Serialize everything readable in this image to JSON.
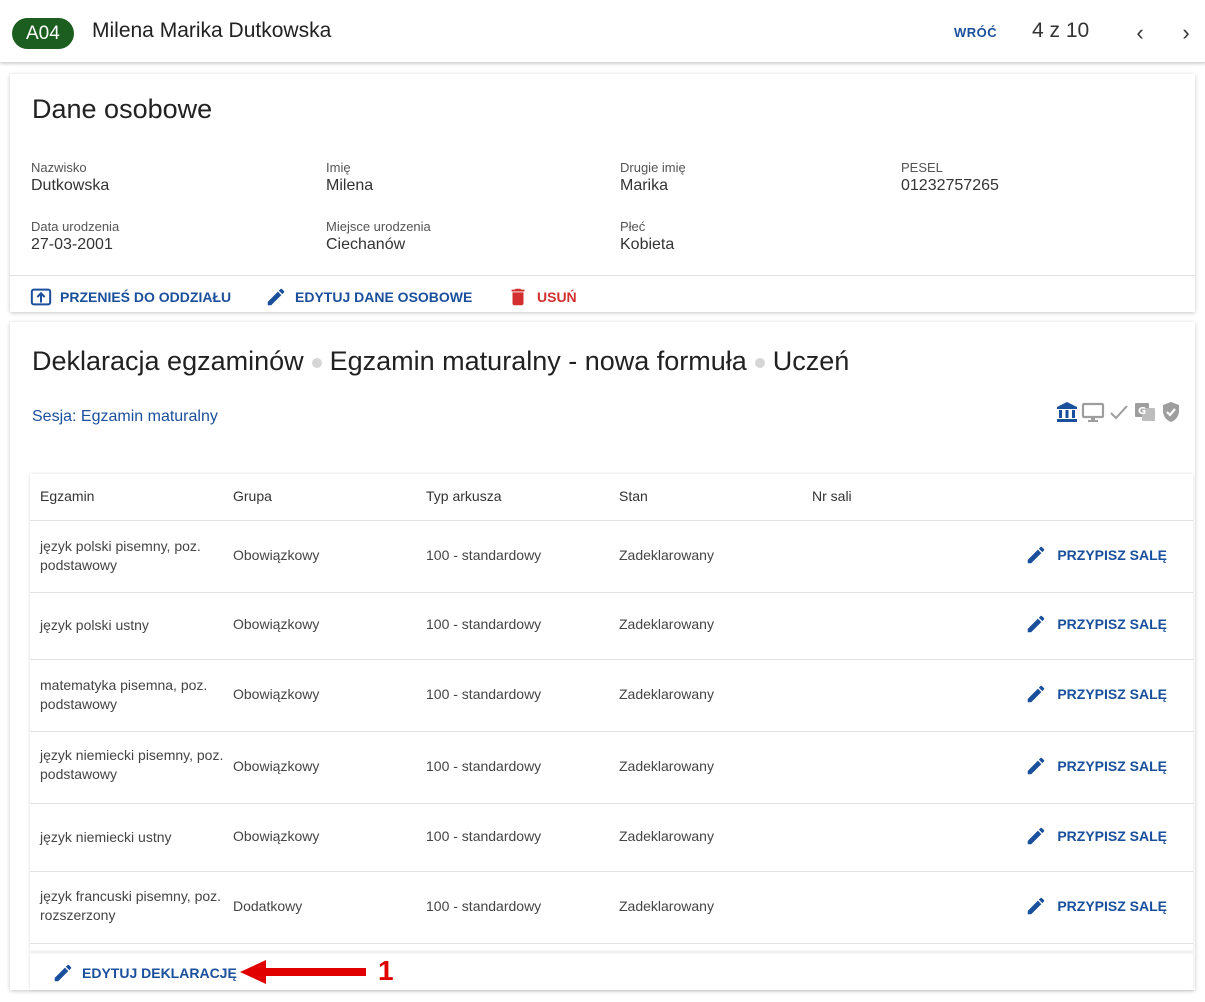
{
  "header": {
    "badge": "A04",
    "student_name": "Milena Marika Dutkowska",
    "back_label": "WRÓĆ",
    "pager": "4 z 10",
    "prev_icon": "chevron-left-icon",
    "next_icon": "chevron-right-icon"
  },
  "personal": {
    "title": "Dane osobowe",
    "fields": [
      {
        "label": "Nazwisko",
        "value": "Dutkowska"
      },
      {
        "label": "Imię",
        "value": "Milena"
      },
      {
        "label": "Drugie imię",
        "value": "Marika"
      },
      {
        "label": "PESEL",
        "value": "01232757265"
      },
      {
        "label": "Data urodzenia",
        "value": "27-03-2001"
      },
      {
        "label": "Miejsce urodzenia",
        "value": "Ciechanów"
      },
      {
        "label": "Płeć",
        "value": "Kobieta"
      }
    ],
    "actions": {
      "move": "PRZENIEŚ DO ODDZIAŁU",
      "edit": "EDYTUJ DANE OSOBOWE",
      "delete": "USUŃ"
    }
  },
  "declaration": {
    "title_parts": [
      "Deklaracja egzaminów",
      "Egzamin maturalny - nowa formuła",
      "Uczeń"
    ],
    "session": "Sesja: Egzamin maturalny",
    "status_icons": [
      "institution-icon",
      "monitor-icon",
      "check-icon",
      "translate-icon",
      "shield-check-icon"
    ],
    "columns": [
      "Egzamin",
      "Grupa",
      "Typ arkusza",
      "Stan",
      "Nr sali"
    ],
    "rows": [
      {
        "exam": "język polski pisemny, poz. podstawowy",
        "group": "Obowiązkowy",
        "sheet": "100 - standardowy",
        "state": "Zadeklarowany",
        "room": "",
        "action": "PRZYPISZ SALĘ"
      },
      {
        "exam": "język polski ustny",
        "group": "Obowiązkowy",
        "sheet": "100 - standardowy",
        "state": "Zadeklarowany",
        "room": "",
        "action": "PRZYPISZ SALĘ"
      },
      {
        "exam": "matematyka pisemna, poz. podstawowy",
        "group": "Obowiązkowy",
        "sheet": "100 - standardowy",
        "state": "Zadeklarowany",
        "room": "",
        "action": "PRZYPISZ SALĘ"
      },
      {
        "exam": "język niemiecki pisemny, poz. podstawowy",
        "group": "Obowiązkowy",
        "sheet": "100 - standardowy",
        "state": "Zadeklarowany",
        "room": "",
        "action": "PRZYPISZ SALĘ"
      },
      {
        "exam": "język niemiecki ustny",
        "group": "Obowiązkowy",
        "sheet": "100 - standardowy",
        "state": "Zadeklarowany",
        "room": "",
        "action": "PRZYPISZ SALĘ"
      },
      {
        "exam": "język francuski pisemny, poz. rozszerzony",
        "group": "Dodatkowy",
        "sheet": "100 - standardowy",
        "state": "Zadeklarowany",
        "room": "",
        "action": "PRZYPISZ SALĘ"
      }
    ],
    "edit_label": "EDYTUJ DEKLARACJĘ"
  },
  "annotation": {
    "number": "1",
    "color": "#e00000"
  },
  "colors": {
    "accent": "#1a4f9c",
    "badge": "#1b5e20",
    "danger": "#d32f2f"
  }
}
